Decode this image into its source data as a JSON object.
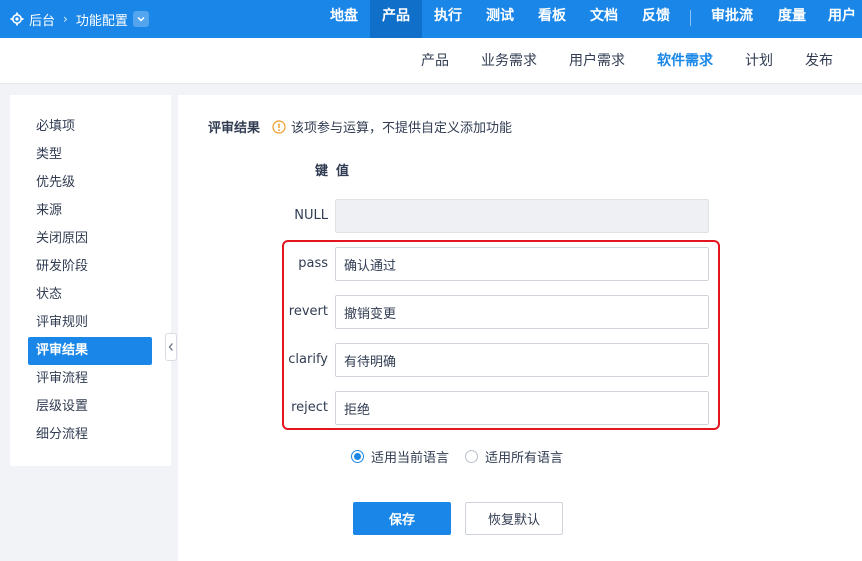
{
  "topbar": {
    "home_label": "后台",
    "breadcrumb_current": "功能配置",
    "nav": [
      {
        "label": "地盘"
      },
      {
        "label": "产品"
      },
      {
        "label": "执行"
      },
      {
        "label": "测试"
      },
      {
        "label": "看板"
      },
      {
        "label": "文档"
      },
      {
        "label": "反馈"
      },
      {
        "label": "审批流"
      },
      {
        "label": "度量"
      },
      {
        "label": "用户"
      }
    ],
    "active_nav": "产品"
  },
  "subnav": {
    "items": [
      {
        "label": "产品"
      },
      {
        "label": "业务需求"
      },
      {
        "label": "用户需求"
      },
      {
        "label": "软件需求"
      },
      {
        "label": "计划"
      },
      {
        "label": "发布"
      }
    ],
    "active": "软件需求"
  },
  "sidebar": {
    "items": [
      {
        "label": "必填项"
      },
      {
        "label": "类型"
      },
      {
        "label": "优先级"
      },
      {
        "label": "来源"
      },
      {
        "label": "关闭原因"
      },
      {
        "label": "研发阶段"
      },
      {
        "label": "状态"
      },
      {
        "label": "评审规则"
      },
      {
        "label": "评审结果"
      },
      {
        "label": "评审流程"
      },
      {
        "label": "层级设置"
      },
      {
        "label": "细分流程"
      }
    ],
    "active": "评审结果"
  },
  "main": {
    "title": "评审结果",
    "hint": "该项参与运算，不提供自定义添加功能",
    "header_key": "键",
    "header_value": "值",
    "rows": [
      {
        "key": "NULL",
        "value": ""
      },
      {
        "key": "pass",
        "value": "确认通过"
      },
      {
        "key": "revert",
        "value": "撤销变更"
      },
      {
        "key": "clarify",
        "value": "有待明确"
      },
      {
        "key": "reject",
        "value": "拒绝"
      }
    ],
    "lang_options": [
      {
        "label": "适用当前语言",
        "checked": true
      },
      {
        "label": "适用所有语言",
        "checked": false
      }
    ],
    "save_label": "保存",
    "reset_label": "恢复默认"
  },
  "colors": {
    "brand": "#1a87e8",
    "highlight_box": "#e3151f"
  }
}
